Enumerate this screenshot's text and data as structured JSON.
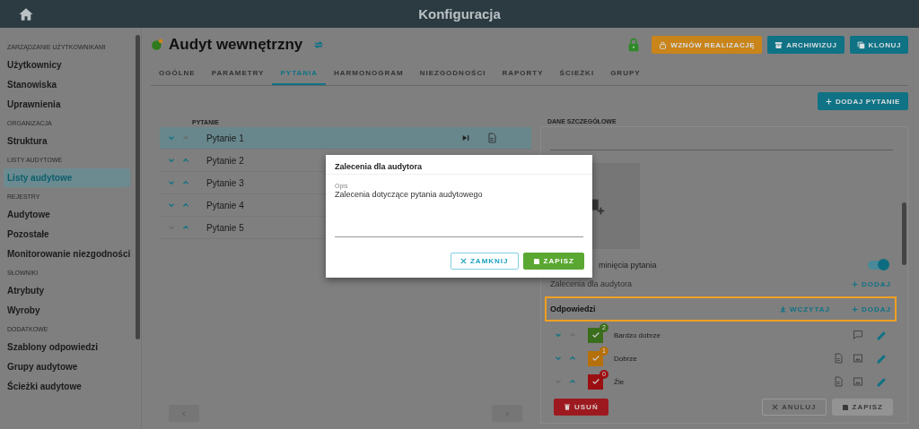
{
  "header": {
    "title": "Konfiguracja"
  },
  "sidebar": {
    "sections": [
      {
        "label": "ZARZĄDZANIE UŻYTKOWNIKAMI",
        "items": [
          {
            "label": "Użytkownicy",
            "selected": false
          },
          {
            "label": "Stanowiska",
            "selected": false
          },
          {
            "label": "Uprawnienia",
            "selected": false
          }
        ]
      },
      {
        "label": "ORGANIZACJA",
        "items": [
          {
            "label": "Struktura",
            "selected": false
          }
        ]
      },
      {
        "label": "LISTY AUDYTOWE",
        "items": [
          {
            "label": "Listy audytowe",
            "selected": true
          }
        ]
      },
      {
        "label": "REJESTRY",
        "items": [
          {
            "label": "Audytowe",
            "selected": false
          },
          {
            "label": "Pozostałe",
            "selected": false
          },
          {
            "label": "Monitorowanie niezgodności",
            "selected": false
          }
        ]
      },
      {
        "label": "SŁOWNIKI",
        "items": [
          {
            "label": "Atrybuty",
            "selected": false
          },
          {
            "label": "Wyroby",
            "selected": false
          }
        ]
      },
      {
        "label": "DODATKOWE",
        "items": [
          {
            "label": "Szablony odpowiedzi",
            "selected": false
          },
          {
            "label": "Grupy audytowe",
            "selected": false
          },
          {
            "label": "Ścieżki audytowe",
            "selected": false
          }
        ]
      }
    ]
  },
  "page": {
    "title": "Audyt wewnętrzny",
    "locked": true,
    "actions": [
      {
        "label": "WZNÓW REALIZACJĘ",
        "kind": "resume"
      },
      {
        "label": "ARCHIWIZUJ",
        "kind": "archive"
      },
      {
        "label": "KLONUJ",
        "kind": "clone"
      }
    ]
  },
  "tabs": [
    {
      "label": "OGÓLNE",
      "selected": false
    },
    {
      "label": "PARAMETRY",
      "selected": false
    },
    {
      "label": "PYTANIA",
      "selected": true
    },
    {
      "label": "HARMONOGRAM",
      "selected": false
    },
    {
      "label": "NIEZGODNOŚCI",
      "selected": false
    },
    {
      "label": "RAPORTY",
      "selected": false
    },
    {
      "label": "ŚCIEŻKI",
      "selected": false
    },
    {
      "label": "GRUPY",
      "selected": false
    }
  ],
  "questions": {
    "column": "PYTANIE",
    "rows": [
      {
        "label": "Pytanie 1",
        "selected": true,
        "down_enabled": true,
        "up_enabled": false
      },
      {
        "label": "Pytanie 2",
        "selected": false,
        "down_enabled": true,
        "up_enabled": true
      },
      {
        "label": "Pytanie 3",
        "selected": false,
        "down_enabled": true,
        "up_enabled": true
      },
      {
        "label": "Pytanie 4",
        "selected": false,
        "down_enabled": true,
        "up_enabled": true
      },
      {
        "label": "Pytanie 5",
        "selected": false,
        "down_enabled": false,
        "up_enabled": true
      }
    ]
  },
  "details": {
    "add_button": "DODAJ PYTANIE",
    "heading": "DANE SZCZEGÓŁOWE",
    "skip_label": "minięcia pytania",
    "skip_on": true,
    "recommendations_label": "Zalecenia dla audytora",
    "recommendations_add": "DODAJ",
    "answers_label": "Odpowiedzi",
    "answers_load": "WCZYTAJ",
    "answers_add": "DODAJ",
    "answers": [
      {
        "label": "Bardzo dobrze",
        "color": "#3b6e1c",
        "count": "2",
        "down_enabled": true,
        "up_enabled": false,
        "has_comment": true,
        "has_document": false,
        "has_image": false
      },
      {
        "label": "Dobrze",
        "color": "#b5700b",
        "count": "1",
        "down_enabled": true,
        "up_enabled": true,
        "has_comment": false,
        "has_document": true,
        "has_image": true
      },
      {
        "label": "Źle",
        "color": "#9b0f12",
        "count": "0",
        "down_enabled": false,
        "up_enabled": true,
        "has_comment": false,
        "has_document": true,
        "has_image": true
      }
    ],
    "delete_button": "USUŃ",
    "cancel_button": {
      "label": "ANULUJ",
      "disabled": true
    },
    "save_button": {
      "label": "ZAPISZ",
      "disabled": true
    }
  },
  "dialog": {
    "title": "Zalecenia dla audytora",
    "field_label": "Opis",
    "field_value": "Zalecenia dotyczące pytania audytowego",
    "close_button": "ZAMKNIJ",
    "save_button": "ZAPISZ"
  }
}
